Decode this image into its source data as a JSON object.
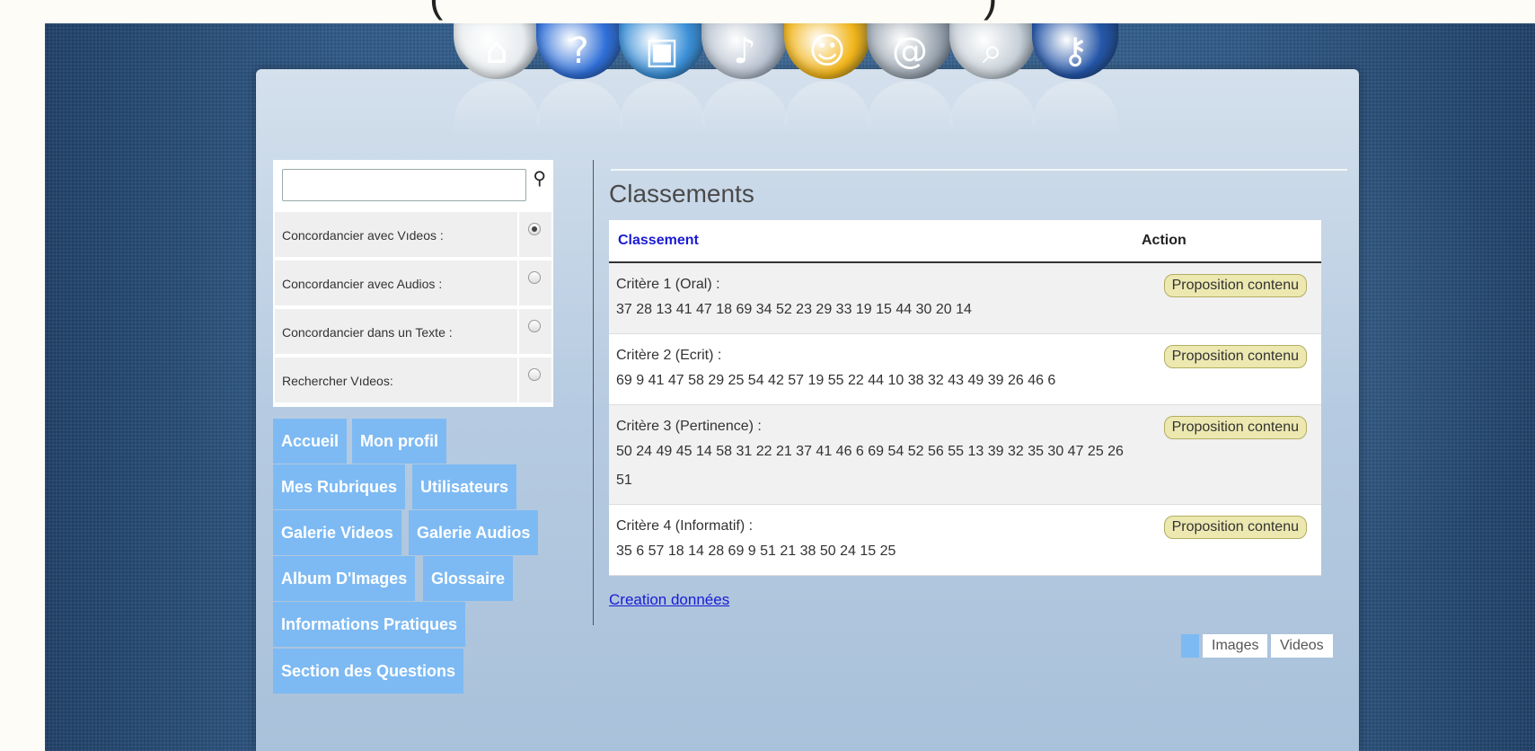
{
  "top_cut_text": {
    "left_paren": "(",
    "right_paren": ")"
  },
  "icon_bar": [
    {
      "name": "home-icon",
      "glyph": "⌂",
      "color": "#e8ecef"
    },
    {
      "name": "help-icon",
      "glyph": "?",
      "color": "#2f6fd8"
    },
    {
      "name": "monitor-icon",
      "glyph": "▣",
      "color": "#3b90d8"
    },
    {
      "name": "music-cd-icon",
      "glyph": "♪",
      "color": "#b8c2d0"
    },
    {
      "name": "user-icon",
      "glyph": "☺",
      "color": "#f2b51a"
    },
    {
      "name": "email-icon",
      "glyph": "@",
      "color": "#9ea8b3"
    },
    {
      "name": "search-doc-icon",
      "glyph": "⌕",
      "color": "#c8d0d8"
    },
    {
      "name": "key-icon",
      "glyph": "⚷",
      "color": "#2456a8"
    }
  ],
  "search": {
    "placeholder": "",
    "options": [
      {
        "label": "Concordancier avec Vıdeos :",
        "checked": true
      },
      {
        "label": "Concordancier avec Audios :",
        "checked": false
      },
      {
        "label": "Concordancier dans un Texte :",
        "checked": false
      },
      {
        "label": "Rechercher Vıdeos:",
        "checked": false
      }
    ]
  },
  "nav": {
    "accueil": "Accueil",
    "mon_profil": "Mon profil",
    "mes_rubriques": "Mes Rubriques",
    "utilisateurs": "Utilisateurs",
    "galerie_videos": "Galerie Videos",
    "galerie_audios": "Galerie Audios",
    "album_images": "Album D'Images",
    "glossaire": "Glossaire",
    "informations_pratiques": "Informations Pratiques",
    "section_questions": "Section des Questions"
  },
  "main": {
    "title": "Classements",
    "columns": {
      "classement": "Classement",
      "action": "Action"
    },
    "rows": [
      {
        "title": "Critère 1 (Oral) :",
        "numbers": "37 28 13 41 47 18 69 34 52 23 29 33 19 15 44 30 20 14",
        "action": "Proposition contenu"
      },
      {
        "title": "Critère 2 (Ecrit) :",
        "numbers": "69 9 41 47 58 29 25 54 42 57 19 55 22 44 10 38 32 43 49 39 26 46 6",
        "action": "Proposition contenu"
      },
      {
        "title": "Critère 3 (Pertinence) :",
        "numbers": "50 24 49 45 14 58 31 22 21 37 41 46 6 69 54 52 56 55 13 39 32 35 30 47 25 26 51",
        "action": "Proposition contenu"
      },
      {
        "title": "Critère 4 (Informatif) :",
        "numbers": "35 6 57 18 14 28 69 9 51 21 38 50 24 15 25",
        "action": "Proposition contenu"
      }
    ],
    "creation_link": "Creation données"
  },
  "media_tabs": {
    "images": "Images",
    "videos": "Videos"
  },
  "colors": {
    "nav_blue": "#7dbaf3",
    "link_blue": "#1a1ad6",
    "button_yellow": "#ece8b0"
  }
}
